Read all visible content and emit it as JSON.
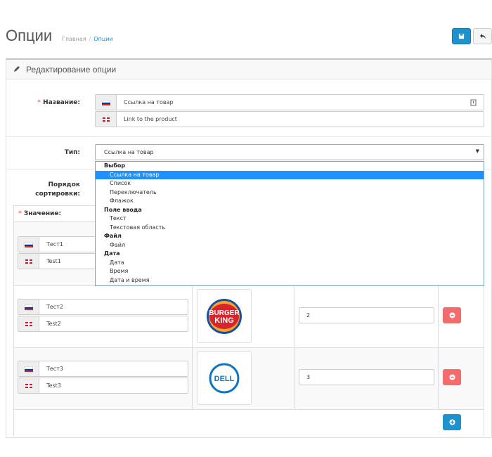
{
  "page": {
    "title": "Опции",
    "breadcrumb": [
      "Главная",
      "Опции"
    ]
  },
  "panel": {
    "title": "Редактирование опции"
  },
  "form": {
    "name_label": "Название:",
    "name_required": "*",
    "name_ru": "Ссылка на товар",
    "name_en": "Link to the product",
    "type_label": "Тип:",
    "type_selected": "Ссылка на товар",
    "sort_label_line1": "Порядок",
    "sort_label_line2": "сортировки:",
    "values_label": "Значение:",
    "values_required": "*"
  },
  "dropdown": {
    "groups": [
      {
        "label": "Выбор",
        "options": [
          "Ссылка на товар",
          "Список",
          "Переключатель",
          "Флажок"
        ]
      },
      {
        "label": "Поле ввода",
        "options": [
          "Текст",
          "Текстовая область"
        ]
      },
      {
        "label": "Файл",
        "options": [
          "Файл"
        ]
      },
      {
        "label": "Дата",
        "options": [
          "Дата",
          "Время",
          "Дата и время"
        ]
      }
    ],
    "selected": "Ссылка на товар"
  },
  "values": [
    {
      "ru": "Тест1",
      "en": "Test1",
      "sort": "",
      "image": ""
    },
    {
      "ru": "Тест2",
      "en": "Test2",
      "sort": "2",
      "image": "burger-king-logo"
    },
    {
      "ru": "Тест3",
      "en": "Test3",
      "sort": "3",
      "image": "dell-logo"
    }
  ],
  "colors": {
    "primary": "#1e91cf",
    "danger": "#f56b6b",
    "required": "#f56b6b",
    "dropdown_highlight": "#1e90ff"
  }
}
